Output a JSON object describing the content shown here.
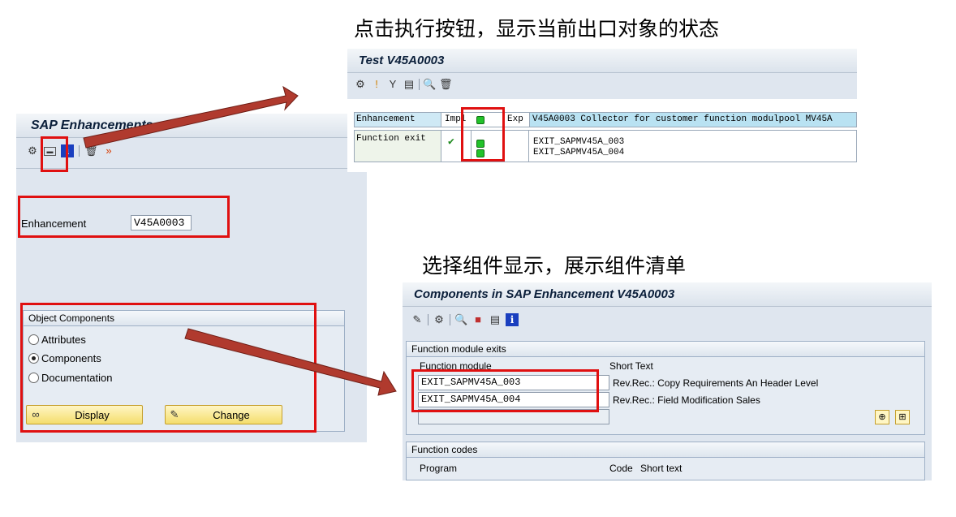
{
  "captions": {
    "top": "点击执行按钮，显示当前出口对象的状态",
    "middle": "选择组件显示，展示组件清单"
  },
  "left_window": {
    "title": "SAP Enhancements",
    "toolbar_icons": [
      "test-icon",
      "components-icon",
      "info-icon",
      "delete-icon",
      "activate-icon"
    ],
    "enhancement_label": "Enhancement",
    "enhancement_value": "V45A0003",
    "group_title": "Object Components",
    "radio_attributes": "Attributes",
    "radio_components": "Components",
    "radio_documentation": "Documentation",
    "selected_radio": "Components",
    "display_button": "Display",
    "change_button": "Change"
  },
  "test_window": {
    "title": "Test V45A0003",
    "header_enh": "Enhancement",
    "header_impl": "Impl",
    "header_exp": "Exp",
    "header_desc": "V45A0003 Collector for customer function modulpool MV45A",
    "row_label": "Function exit",
    "exit1": "EXIT_SAPMV45A_003",
    "exit2": "EXIT_SAPMV45A_004",
    "status_color": "#22c22a"
  },
  "components_window": {
    "title": "Components in SAP Enhancement V45A0003",
    "group1_title": "Function module exits",
    "col_function_module": "Function module",
    "col_short_text": "Short Text",
    "rows": [
      {
        "module": "EXIT_SAPMV45A_003",
        "text": "Rev.Rec.: Copy Requirements An Header Level"
      },
      {
        "module": "EXIT_SAPMV45A_004",
        "text": "Rev.Rec.: Field Modification Sales"
      }
    ],
    "group2_title": "Function codes",
    "col_program": "Program",
    "col_code": "Code",
    "col_short_text2": "Short text"
  },
  "colors": {
    "highlight": "#e01010",
    "arrow": "#b03a2e",
    "accent_blue": "#1a3fbf"
  }
}
